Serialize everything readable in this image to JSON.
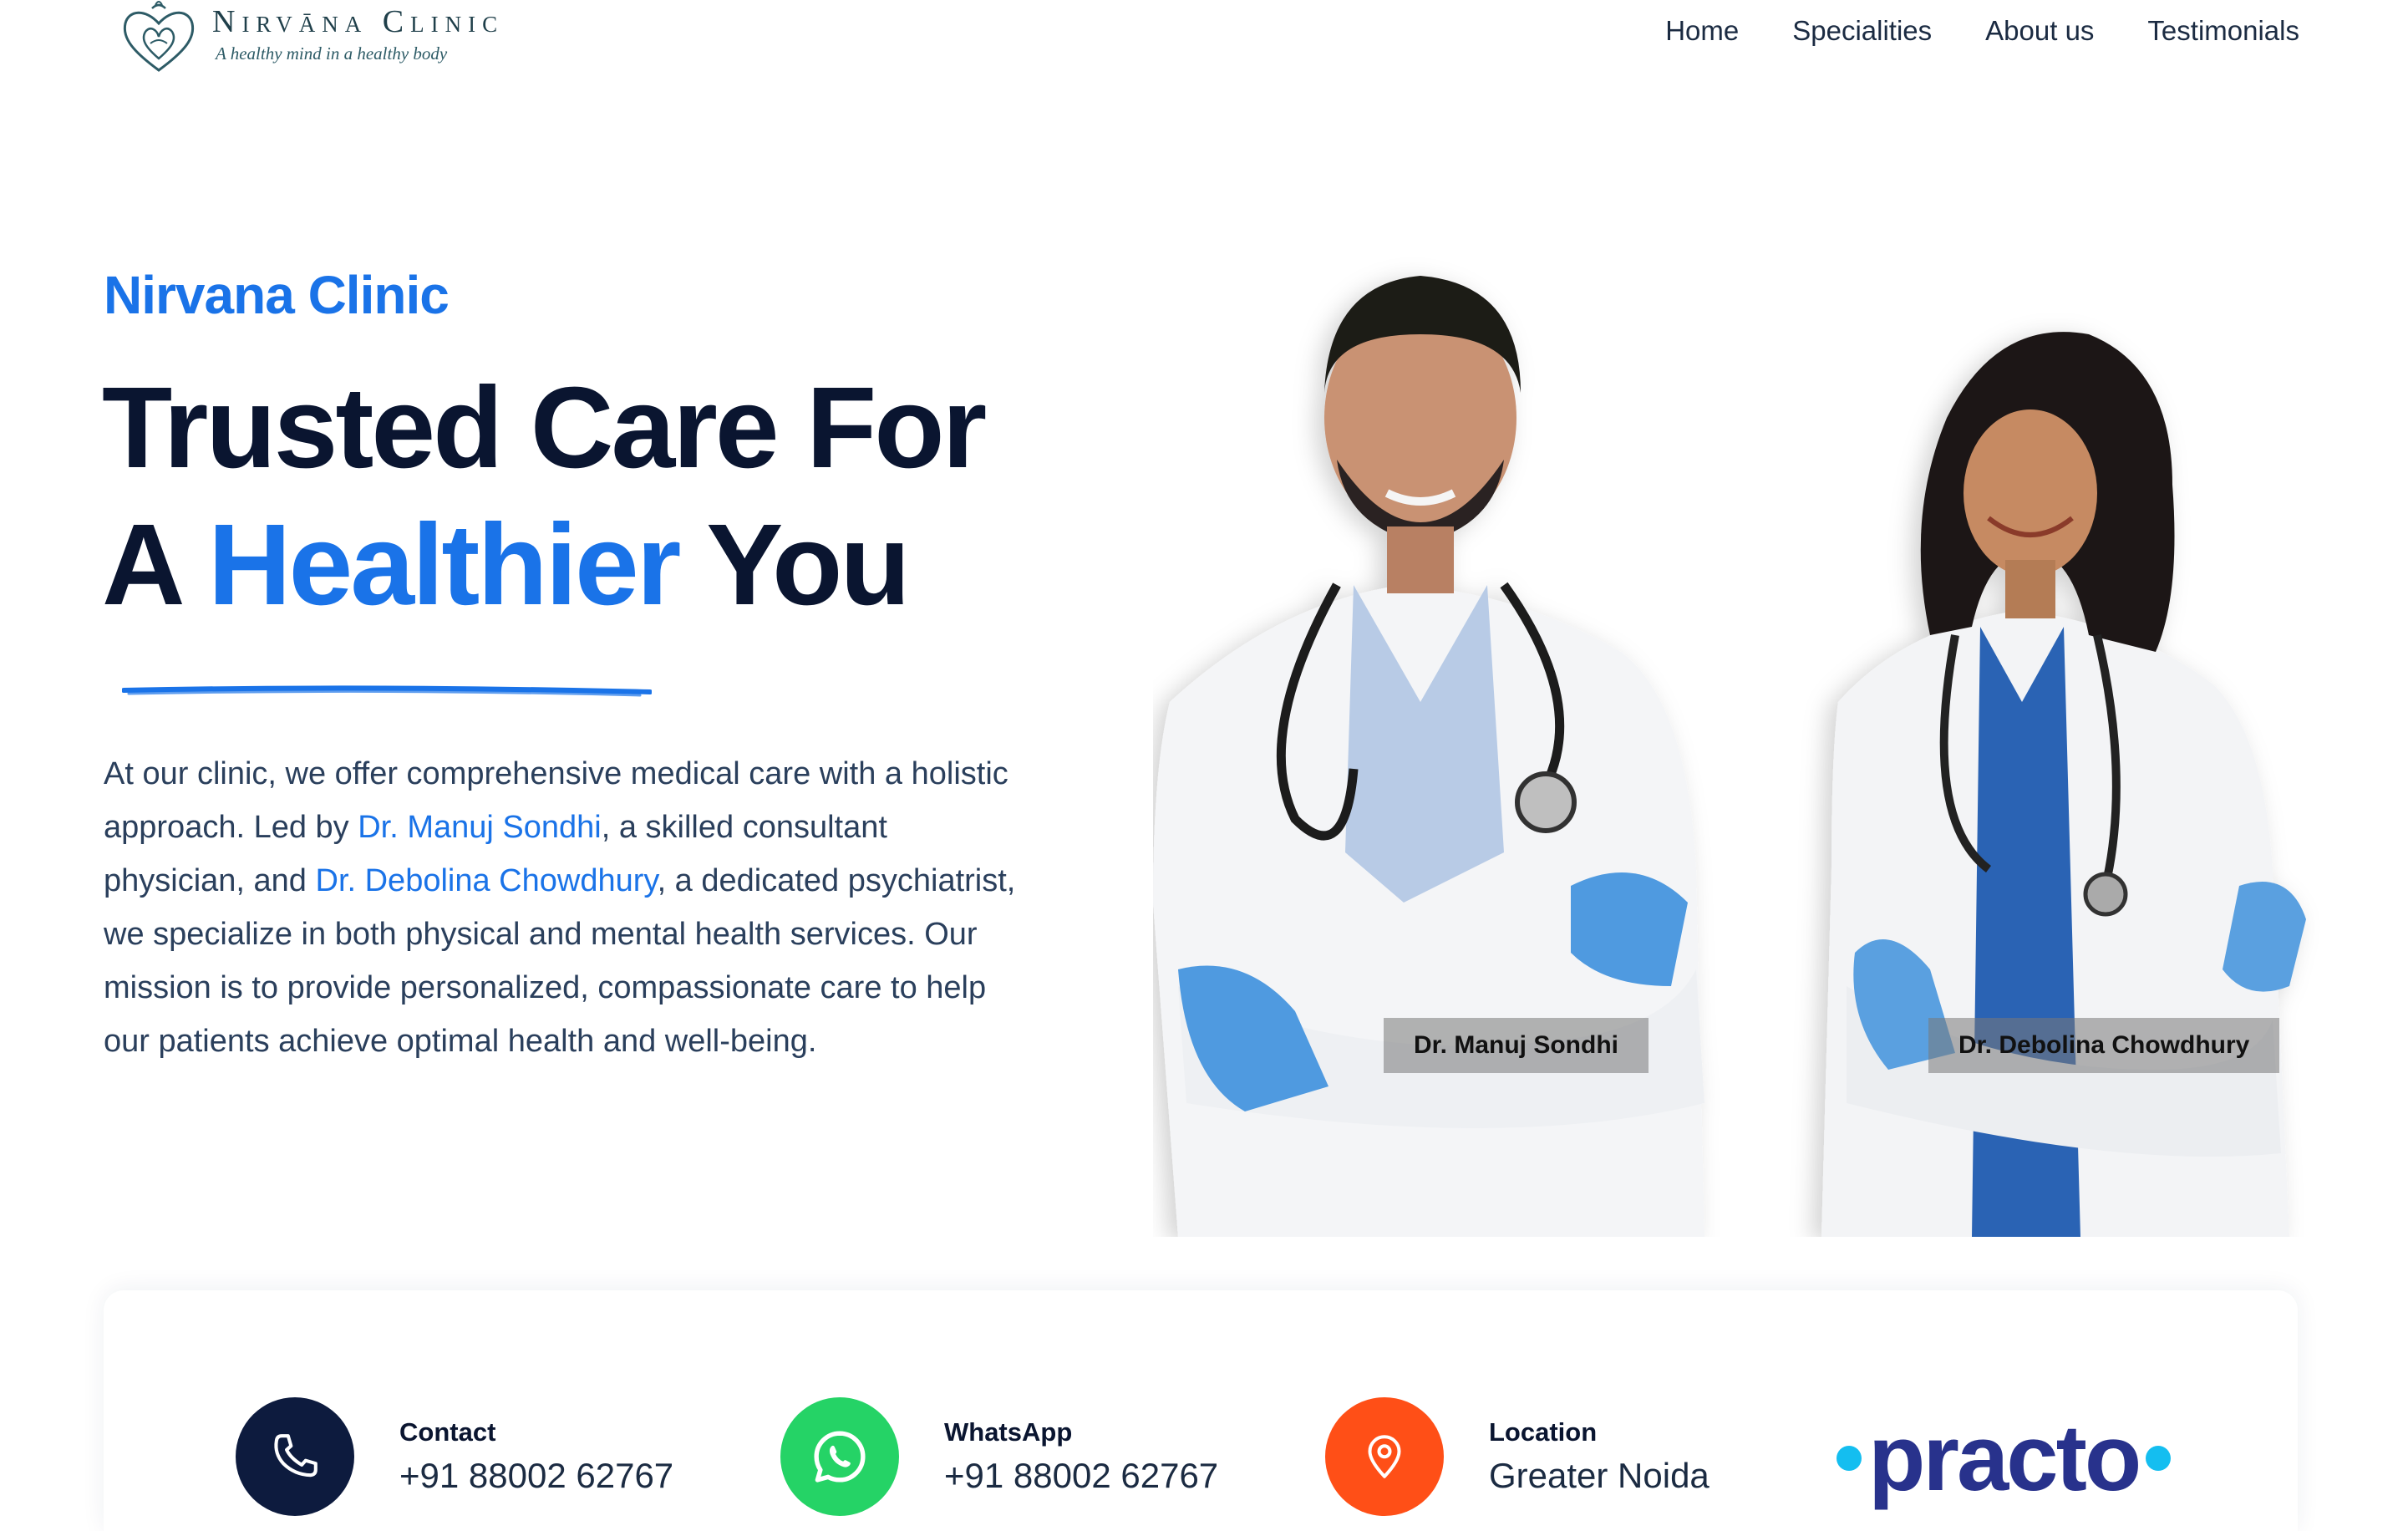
{
  "brand": {
    "logo_name": "Nirvāna Clinic",
    "logo_tagline": "A healthy mind in a healthy body"
  },
  "nav": {
    "items": [
      {
        "label": "Home"
      },
      {
        "label": "Specialities"
      },
      {
        "label": "About us"
      },
      {
        "label": "Testimonials"
      }
    ]
  },
  "hero": {
    "eyebrow": "Nirvana Clinic",
    "headline_line1": "Trusted Care For",
    "headline_line2_start": "A ",
    "headline_accent": "Healthier",
    "headline_line2_end": " You",
    "intro_part1": "At our clinic, we offer comprehensive medical care with a holistic approach. Led by ",
    "doctor1_link": "Dr. Manuj Sondhi",
    "intro_part2": ", a skilled consultant physician, and ",
    "doctor2_link": "Dr. Debolina Chowdhury",
    "intro_part3": ", a dedicated psychiatrist, we specialize in both physical and mental health services. Our mission is to provide personalized, compassionate care to help our patients achieve optimal health and well-being."
  },
  "doctors": [
    {
      "name_tag": "Dr. Manuj Sondhi"
    },
    {
      "name_tag": "Dr. Debolina Chowdhury"
    }
  ],
  "info_bar": {
    "contact": {
      "label": "Contact",
      "value": "+91 88002 62767",
      "icon": "phone-icon"
    },
    "whatsapp": {
      "label": "WhatsApp",
      "value": "+91 88002 62767",
      "icon": "whatsapp-icon"
    },
    "location": {
      "label": "Location",
      "value": "Greater Noida",
      "icon": "location-pin-icon"
    },
    "practo": {
      "label": "practo"
    }
  },
  "colors": {
    "accent": "#1a73e8",
    "dark": "#0a1530",
    "contact_icon_bg": "#0d1b3e",
    "whatsapp_icon_bg": "#25d366",
    "location_icon_bg": "#ff4f17",
    "practo_text": "#28328c",
    "practo_dot": "#14bef0"
  }
}
